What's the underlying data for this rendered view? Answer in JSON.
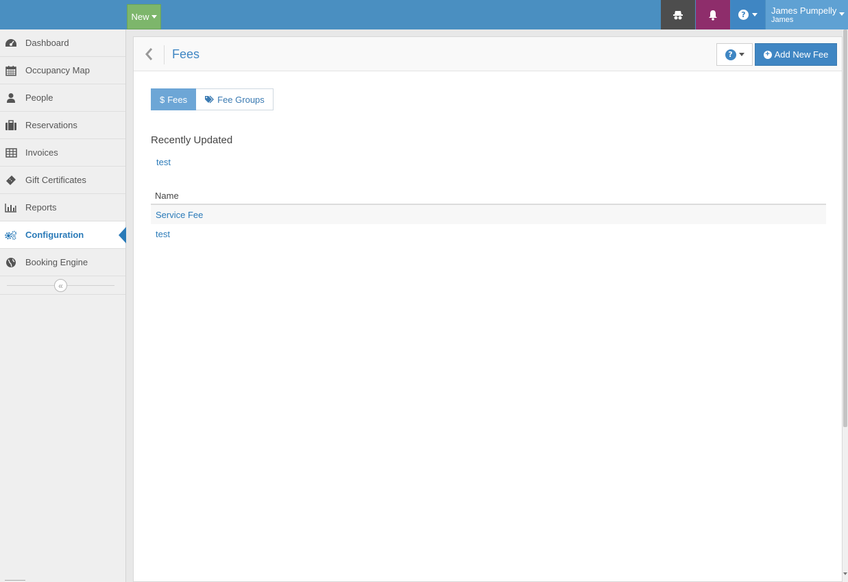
{
  "topbar": {
    "new_label": "New",
    "user_name": "James Pumpelly",
    "user_sub": "James",
    "colors": {
      "bar": "#4a8fc1",
      "new": "#7db66b",
      "ghost": "#4d4d4d",
      "bell": "#8e2d6b",
      "help": "#3f86c3",
      "user": "#5fa1d3"
    }
  },
  "sidebar": {
    "items": [
      {
        "label": "Dashboard",
        "icon": "dashboard-icon"
      },
      {
        "label": "Occupancy Map",
        "icon": "calendar-icon"
      },
      {
        "label": "People",
        "icon": "person-icon"
      },
      {
        "label": "Reservations",
        "icon": "briefcase-icon"
      },
      {
        "label": "Invoices",
        "icon": "table-icon"
      },
      {
        "label": "Gift Certificates",
        "icon": "ticket-icon"
      },
      {
        "label": "Reports",
        "icon": "bar-chart-icon"
      },
      {
        "label": "Configuration",
        "icon": "gears-icon",
        "active": true
      },
      {
        "label": "Booking Engine",
        "icon": "globe-icon"
      }
    ],
    "collapse_glyph": "«"
  },
  "main": {
    "title": "Fees",
    "add_button": "Add New Fee",
    "tabs": [
      {
        "label": "Fees",
        "prefix": "$",
        "active": true
      },
      {
        "label": "Fee Groups",
        "icon": "tags-icon",
        "active": false
      }
    ],
    "recent": {
      "title": "Recently Updated",
      "items": [
        "test"
      ]
    },
    "table": {
      "header": "Name",
      "rows": [
        "Service Fee",
        "test"
      ]
    }
  }
}
